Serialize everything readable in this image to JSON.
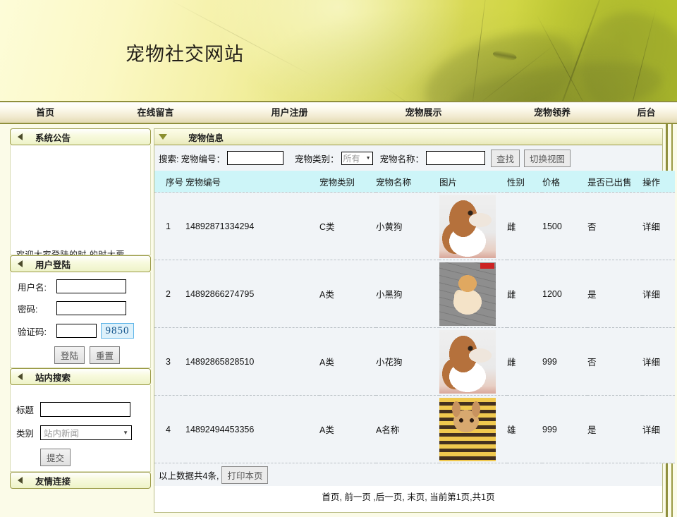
{
  "banner": {
    "title": "宠物社交网站"
  },
  "nav": {
    "items": [
      {
        "label": "首页"
      },
      {
        "label": "在线留言"
      },
      {
        "label": "用户注册"
      },
      {
        "label": "宠物展示"
      },
      {
        "label": "宠物领养"
      },
      {
        "label": "后台"
      }
    ]
  },
  "sidebar": {
    "notice": {
      "title": "系统公告",
      "text": "欢迎大家登陆的时 的时大要"
    },
    "login": {
      "title": "用户登陆",
      "username_label": "用户名:",
      "username_value": "",
      "password_label": "密码:",
      "password_value": "",
      "captcha_label": "验证码:",
      "captcha_value": "",
      "captcha_code": "9850",
      "login_button": "登陆",
      "reset_button": "重置"
    },
    "search": {
      "title": "站内搜索",
      "title_label": "标题",
      "title_value": "",
      "category_label": "类别",
      "category_value": "站内新闻",
      "submit_button": "提交"
    },
    "links": {
      "title": "友情连接"
    }
  },
  "main": {
    "panel_title": "宠物信息",
    "searchbar": {
      "prefix": "搜索:",
      "pet_no_label": "宠物编号：",
      "pet_no_value": "",
      "pet_type_label": "宠物类别：",
      "pet_type_value": "所有",
      "pet_name_label": "宠物名称：",
      "pet_name_value": "",
      "find_button": "查找",
      "switch_view_button": "切换视图"
    },
    "table": {
      "headers": [
        "序号",
        "宠物编号",
        "宠物类别",
        "宠物名称",
        "图片",
        "性别",
        "价格",
        "是否已出售",
        "操作"
      ],
      "rows": [
        {
          "idx": "1",
          "no": "14892871334294",
          "type": "C类",
          "name": "小黄狗",
          "img": "beagle-photo",
          "sex": "雌",
          "price": "1500",
          "sold": "否",
          "op": "详细"
        },
        {
          "idx": "2",
          "no": "14892866274795",
          "type": "A类",
          "name": "小黑狗",
          "img": "pomeranian-photo",
          "sex": "雌",
          "price": "1200",
          "sold": "是",
          "op": "详细"
        },
        {
          "idx": "3",
          "no": "14892865828510",
          "type": "A类",
          "name": "小花狗",
          "img": "beagle-photo",
          "sex": "雌",
          "price": "999",
          "sold": "否",
          "op": "详细"
        },
        {
          "idx": "4",
          "no": "14892494453356",
          "type": "A类",
          "name": "A名称",
          "img": "corgi-costume-photo",
          "sex": "雄",
          "price": "999",
          "sold": "是",
          "op": "详细"
        }
      ]
    },
    "footer": {
      "total_text": "以上数据共4条,",
      "print_button": "打印本页"
    },
    "pager": {
      "first": "首页,",
      "prev": "前一页 ,",
      "next": "后一页,",
      "last": "末页,",
      "status": "当前第1页,共1页"
    }
  },
  "colors": {
    "nav_border": "#8f8f3c",
    "panel_border": "#9a9a46",
    "table_header_bg": "#cdf5f8",
    "row_bg": "#f1f4f7",
    "captcha_text": "#15558c"
  }
}
